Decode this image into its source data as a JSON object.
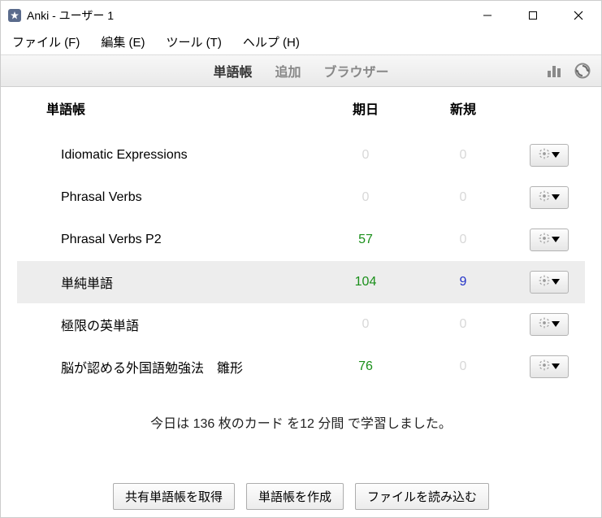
{
  "window": {
    "title": "Anki - ユーザー 1"
  },
  "menu": {
    "file": "ファイル (F)",
    "edit": "編集 (E)",
    "tools": "ツール (T)",
    "help": "ヘルプ (H)"
  },
  "toolbar": {
    "decks": "単語帳",
    "add": "追加",
    "browser": "ブラウザー"
  },
  "headers": {
    "deck": "単語帳",
    "due": "期日",
    "new": "新規"
  },
  "decks": [
    {
      "name": "Idiomatic Expressions",
      "due": 0,
      "new": 0,
      "selected": false
    },
    {
      "name": "Phrasal Verbs",
      "due": 0,
      "new": 0,
      "selected": false
    },
    {
      "name": "Phrasal Verbs P2",
      "due": 57,
      "new": 0,
      "selected": false
    },
    {
      "name": "単純単語",
      "due": 104,
      "new": 9,
      "selected": true
    },
    {
      "name": "極限の英単語",
      "due": 0,
      "new": 0,
      "selected": false
    },
    {
      "name": "脳が認める外国語勉強法　雛形",
      "due": 76,
      "new": 0,
      "selected": false
    }
  ],
  "summary": "今日は 136 枚のカード を12 分間 で学習しました。",
  "buttons": {
    "get_shared": "共有単語帳を取得",
    "create_deck": "単語帳を作成",
    "import_file": "ファイルを読み込む"
  }
}
